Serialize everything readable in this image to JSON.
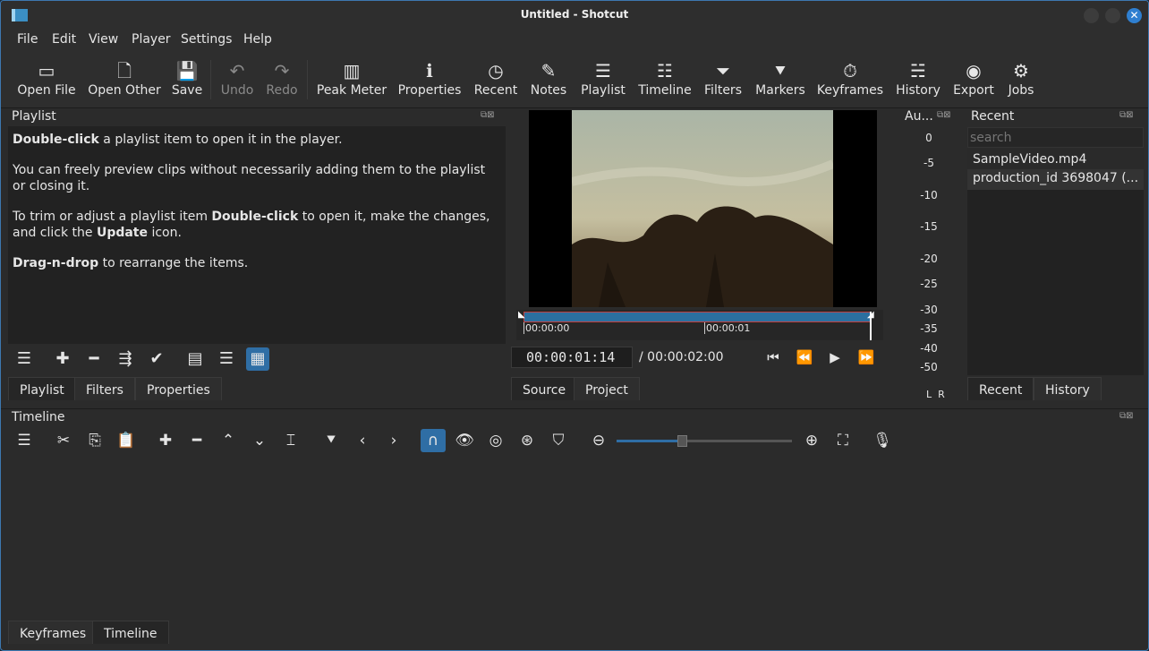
{
  "window": {
    "title": "Untitled - Shotcut"
  },
  "menu": [
    "File",
    "Edit",
    "View",
    "Player",
    "Settings",
    "Help"
  ],
  "toolbar": [
    {
      "label": "Open File",
      "icon": "open-file-icon",
      "glyph": "▭"
    },
    {
      "label": "Open Other",
      "icon": "open-other-icon",
      "glyph": "🗋"
    },
    {
      "label": "Save",
      "icon": "save-icon",
      "glyph": "💾"
    },
    {
      "label": "Undo",
      "icon": "undo-icon",
      "glyph": "↶"
    },
    {
      "label": "Redo",
      "icon": "redo-icon",
      "glyph": "↷"
    },
    {
      "label": "Peak Meter",
      "icon": "peak-meter-icon",
      "glyph": "▥"
    },
    {
      "label": "Properties",
      "icon": "properties-icon",
      "glyph": "ℹ"
    },
    {
      "label": "Recent",
      "icon": "recent-icon",
      "glyph": "◷"
    },
    {
      "label": "Notes",
      "icon": "notes-icon",
      "glyph": "✎"
    },
    {
      "label": "Playlist",
      "icon": "playlist-icon",
      "glyph": "☰"
    },
    {
      "label": "Timeline",
      "icon": "timeline-icon",
      "glyph": "☷"
    },
    {
      "label": "Filters",
      "icon": "filters-icon",
      "glyph": "⏷"
    },
    {
      "label": "Markers",
      "icon": "markers-icon",
      "glyph": "⯆"
    },
    {
      "label": "Keyframes",
      "icon": "keyframes-icon",
      "glyph": "⏱"
    },
    {
      "label": "History",
      "icon": "history-icon",
      "glyph": "☵"
    },
    {
      "label": "Export",
      "icon": "export-icon",
      "glyph": "◉"
    },
    {
      "label": "Jobs",
      "icon": "jobs-icon",
      "glyph": "⚙"
    }
  ],
  "playlist": {
    "title": "Playlist",
    "p1_bold": "Double-click",
    "p1_rest": " a playlist item to open it in the player.",
    "p2": "You can freely preview clips without necessarily adding them to the playlist or closing it.",
    "p3_a": "To trim or adjust a playlist item ",
    "p3_b": "Double-click",
    "p3_c": " to open it, make the changes, and click the ",
    "p3_d": "Update",
    "p3_e": " icon.",
    "p4_bold": "Drag-n-drop",
    "p4_rest": " to rearrange the items.",
    "tabs": [
      "Playlist",
      "Filters",
      "Properties"
    ]
  },
  "player": {
    "timecode": "00:00:01:14",
    "duration": "/ 00:00:02:00",
    "ruler": [
      "00:00:00",
      "00:00:01"
    ],
    "tabs": [
      "Source",
      "Project"
    ]
  },
  "audio": {
    "title": "Au...",
    "scale": [
      "0",
      "-5",
      "-10",
      "-15",
      "-20",
      "-25",
      "-30",
      "-35",
      "-40",
      "-50"
    ],
    "channels": "L  R"
  },
  "recent": {
    "title": "Recent",
    "search_placeholder": "search",
    "items": [
      "SampleVideo.mp4",
      "production_id 3698047 (..."
    ],
    "tabs": [
      "Recent",
      "History"
    ]
  },
  "timeline": {
    "title": "Timeline",
    "zoom": 0.37
  },
  "bottom_tabs": [
    "Keyframes",
    "Timeline"
  ],
  "colors": {
    "accent": "#2f6ea5",
    "playhead": "#d04040"
  }
}
